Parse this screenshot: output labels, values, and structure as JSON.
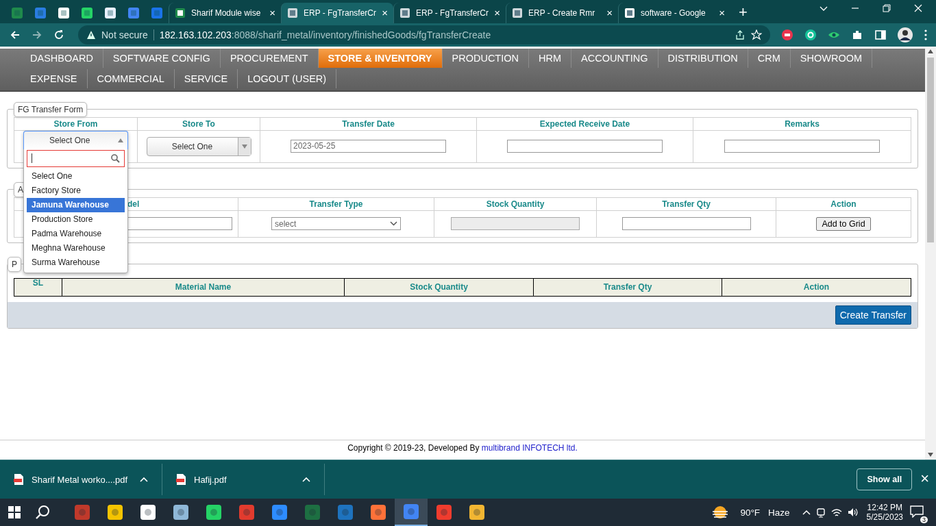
{
  "browser": {
    "tabs": [
      {
        "title": "Sharif Module wise",
        "selected": false
      },
      {
        "title": "ERP - FgTransferCr",
        "selected": true
      },
      {
        "title": "ERP - FgTransferCr",
        "selected": false
      },
      {
        "title": "ERP - Create Rmr",
        "selected": false
      },
      {
        "title": "software - Google",
        "selected": false
      }
    ],
    "close_glyph": "×",
    "new_tab": "+",
    "security": "Not secure",
    "url_host": "182.163.102.203",
    "url_path": ":8088/sharif_metal/inventory/finishedGoods/fgTransferCreate"
  },
  "nav": [
    {
      "label": "DASHBOARD",
      "selected": false
    },
    {
      "label": "SOFTWARE CONFIG",
      "selected": false
    },
    {
      "label": "PROCUREMENT",
      "selected": false
    },
    {
      "label": "STORE & INVENTORY",
      "selected": true
    },
    {
      "label": "PRODUCTION",
      "selected": false
    },
    {
      "label": "HRM",
      "selected": false
    },
    {
      "label": "ACCOUNTING",
      "selected": false
    },
    {
      "label": "DISTRIBUTION",
      "selected": false
    },
    {
      "label": "CRM",
      "selected": false
    },
    {
      "label": "SHOWROOM",
      "selected": false
    },
    {
      "label": "EXPENSE",
      "selected": false
    },
    {
      "label": "COMMERCIAL",
      "selected": false
    },
    {
      "label": "SERVICE",
      "selected": false
    },
    {
      "label": "LOGOUT (USER)",
      "selected": false
    }
  ],
  "form": {
    "legend": "FG Transfer Form",
    "columns": [
      "Store From",
      "Store To",
      "Transfer Date",
      "Expected Receive Date",
      "Remarks"
    ],
    "store_from": "Select One",
    "store_to": "Select One",
    "transfer_date": "2023-05-25"
  },
  "dropdown": {
    "options": [
      {
        "label": "Select One",
        "selected": false
      },
      {
        "label": "Factory Store",
        "selected": false
      },
      {
        "label": "Jamuna Warehouse",
        "selected": true
      },
      {
        "label": "Production Store",
        "selected": false
      },
      {
        "label": "Padma Warehouse",
        "selected": false
      },
      {
        "label": "Meghna Warehouse",
        "selected": false
      },
      {
        "label": "Surma Warehouse",
        "selected": false
      }
    ]
  },
  "add_section": {
    "legend": "A",
    "columns": [
      "del",
      "Transfer Type",
      "Stock Quantity",
      "Transfer Qty",
      "Action"
    ],
    "transfer_type": "select",
    "button": "Add to Grid"
  },
  "product_section": {
    "legend": "P",
    "columns": [
      "SL",
      "Material Name",
      "Stock Quantity",
      "Transfer Qty",
      "Action"
    ],
    "button": "Create Transfer"
  },
  "footer": {
    "text": "Copyright © 2019-23, Developed By",
    "link": "multibrand INFOTECH ltd."
  },
  "downloads": {
    "items": [
      "Sharif Metal worko....pdf",
      "Hafij.pdf"
    ],
    "show_all": "Show all",
    "close": "×"
  },
  "taskbar": {
    "temperature": "90°F",
    "weather": "Haze",
    "time": "12:42 PM",
    "date": "5/25/2023",
    "notifications": "3"
  }
}
